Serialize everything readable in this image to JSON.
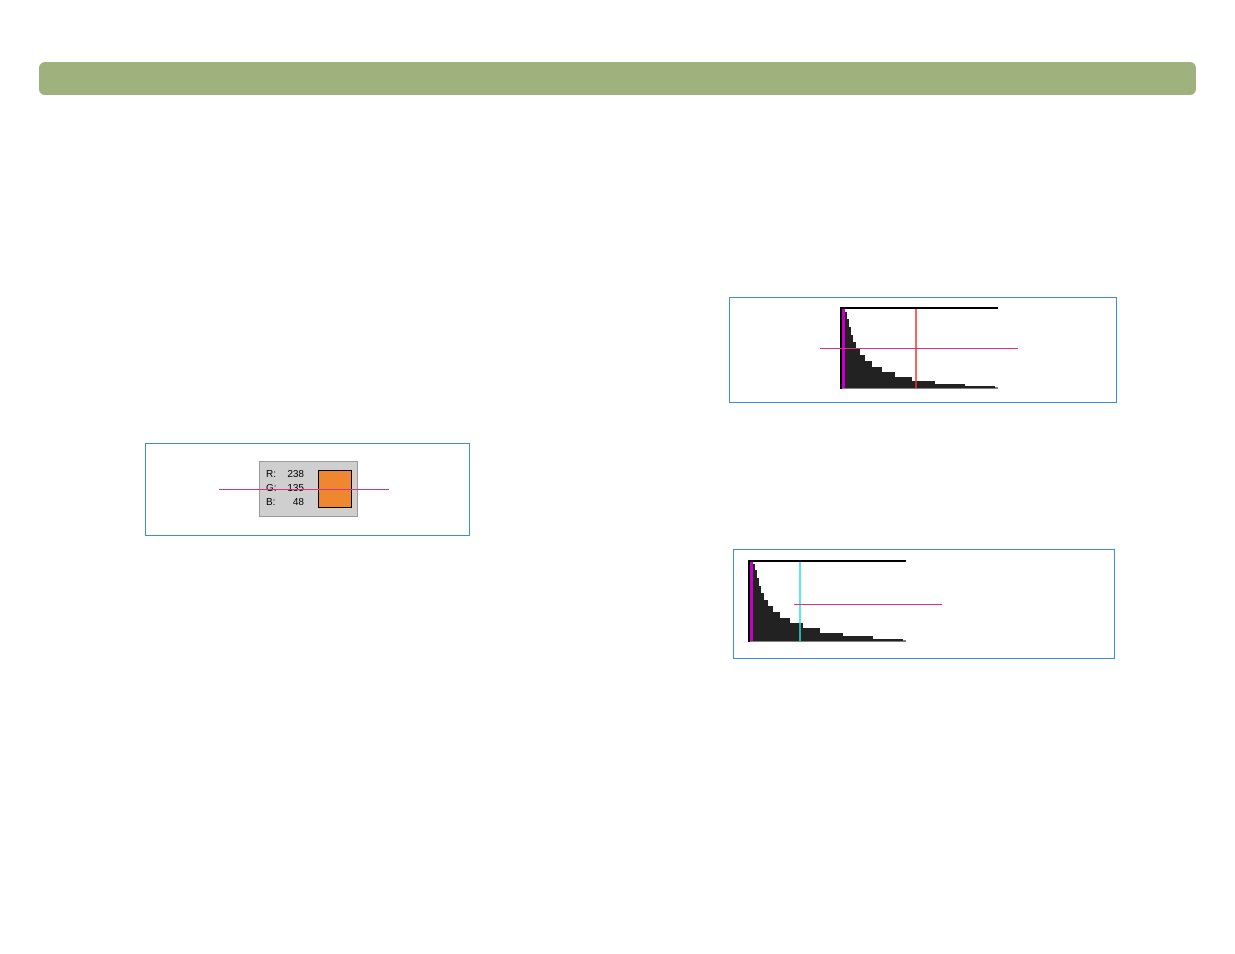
{
  "rgb_panel": {
    "r_label": "R:",
    "g_label": "G:",
    "b_label": "B:",
    "r_value": "238",
    "g_value": "135",
    "b_value": "48",
    "swatch_color": "#ee8730"
  },
  "histogram_top": {
    "marker_color": "red",
    "marker_x_fraction": 0.48,
    "left_accent_color": "magenta"
  },
  "histogram_bottom": {
    "marker_color": "cyan",
    "marker_x_fraction": 0.33,
    "left_accent_color": "magenta"
  }
}
